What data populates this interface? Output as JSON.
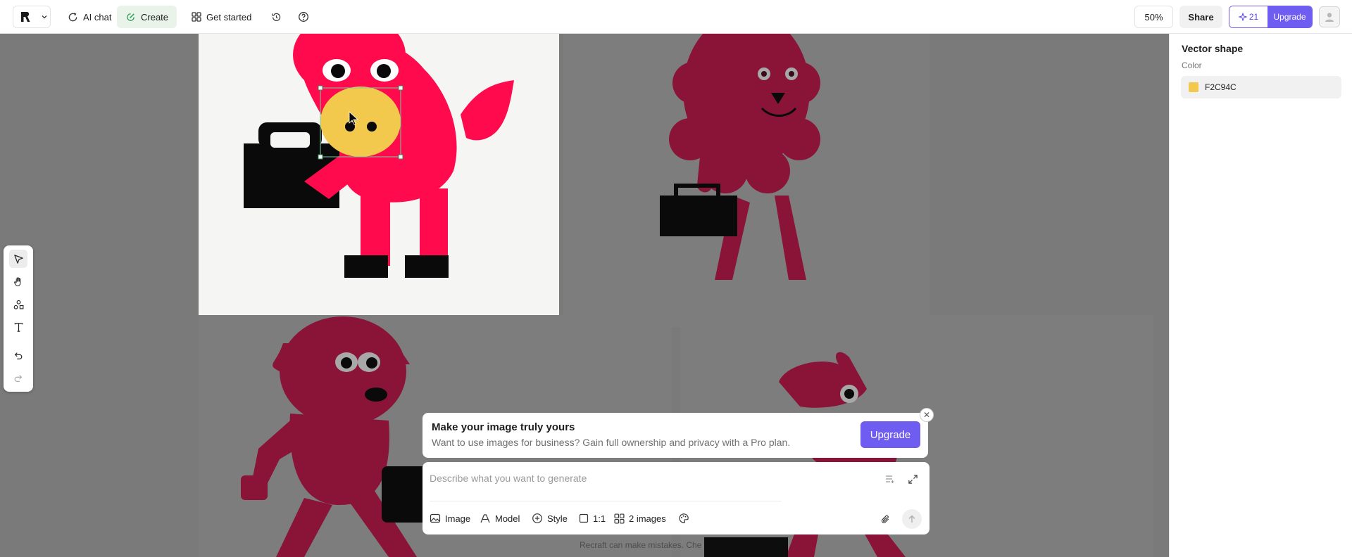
{
  "topbar": {
    "logo_icon": "recraft-logo",
    "ai_chat_label": "AI chat",
    "create_label": "Create",
    "get_started_label": "Get started",
    "zoom_label": "50%",
    "share_label": "Share",
    "credits_count": "21",
    "upgrade_label": "Upgrade"
  },
  "panel": {
    "title": "Vector shape",
    "color_label": "Color",
    "color_value": "F2C94C",
    "color_hex": "#F2C94C"
  },
  "banner": {
    "title": "Make your image truly yours",
    "subtitle": "Want to use images for business? Gain full ownership and privacy with a Pro plan.",
    "button_label": "Upgrade"
  },
  "prompt": {
    "placeholder": "Describe what you want to generate",
    "options": {
      "image": "Image",
      "model": "Model",
      "style": "Style",
      "ratio": "1:1",
      "count": "2 images"
    }
  },
  "disclaimer": "Recraft can make mistakes. Che",
  "colors": {
    "accent": "#6F5CF0",
    "create_green": "#2FA15C",
    "character_pink": "#FF0A4C",
    "character_dim": "#8A1438",
    "selected_fill": "#F2C94C"
  }
}
